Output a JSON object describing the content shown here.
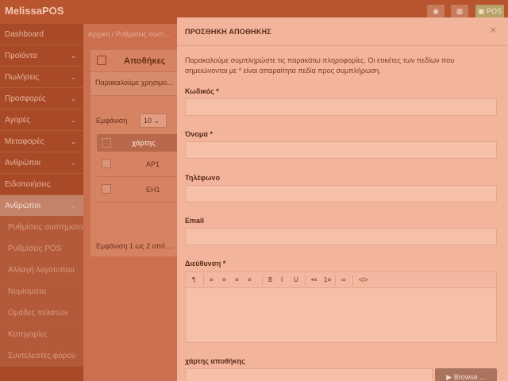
{
  "app": {
    "brand": "MelissaPOS",
    "top_pos_label": "POS"
  },
  "sidebar": {
    "items": [
      {
        "label": "Dashboard",
        "chevron": false,
        "state": "normal"
      },
      {
        "label": "Προϊόντα",
        "chevron": true,
        "state": "normal"
      },
      {
        "label": "Πωλήσεις",
        "chevron": true,
        "state": "normal"
      },
      {
        "label": "Προσφορές",
        "chevron": true,
        "state": "normal"
      },
      {
        "label": "Αγορές",
        "chevron": true,
        "state": "normal"
      },
      {
        "label": "Μεταφορές",
        "chevron": true,
        "state": "normal"
      },
      {
        "label": "Ανθρώποι",
        "chevron": true,
        "state": "normal"
      },
      {
        "label": "Ειδοποιήσεις",
        "chevron": false,
        "state": "normal"
      },
      {
        "label": "Ανθρώποι",
        "chevron": true,
        "state": "active"
      },
      {
        "label": "Ρυθμίσεις συστήματος",
        "chevron": false,
        "state": "sub"
      },
      {
        "label": "Ρυθμίσεις POS",
        "chevron": false,
        "state": "sub"
      },
      {
        "label": "Αλλαγή λογότυπου",
        "chevron": false,
        "state": "sub"
      },
      {
        "label": "Νομίσματα",
        "chevron": false,
        "state": "sub"
      },
      {
        "label": "Ομάδες πελατών",
        "chevron": false,
        "state": "sub"
      },
      {
        "label": "Κατηγορίες",
        "chevron": false,
        "state": "sub"
      },
      {
        "label": "Συντελεστές φόρου",
        "chevron": false,
        "state": "sub"
      }
    ]
  },
  "main": {
    "breadcrumb": "Αρχική / Ρυθμίσεις συστ...",
    "panel_title": "Αποθήκες",
    "panel_note": "Παρακαλούμε χρησιμο...",
    "show_label": "Εμφάνιση",
    "page_size": "10",
    "table": {
      "column_header": "χάρτης",
      "rows": [
        {
          "code": "ΑΡ1"
        },
        {
          "code": "ΕΗ1"
        }
      ]
    },
    "paging": "Εμφάνιση 1 ως 2 από ..."
  },
  "modal": {
    "title": "ΠΡΟΣΘΗΚΗ ΑΠΟΘΗΚΗΣ",
    "close_glyph": "×",
    "intro": "Παρακαλούμε συμπληρώστε τις παρακάτω πληροφορίες. Οι ετικέτες των πεδίων που σημειώνονται με * είναι απαραίτητα πεδία προς συμπλήρωση.",
    "fields": {
      "code_label": "Κωδικός *",
      "name_label": "Όνομα *",
      "phone_label": "Τηλέφωνο",
      "email_label": "Email",
      "address_label": "Διεύθυνση *",
      "map_label": "χάρτης αποθήκης"
    },
    "editor_tools": [
      "¶",
      "≡",
      "≡",
      "≡",
      "≡",
      "B",
      "I",
      "U",
      "•≡",
      "1≡",
      "∞",
      "</>"
    ],
    "browse_label": "Browse ..."
  }
}
